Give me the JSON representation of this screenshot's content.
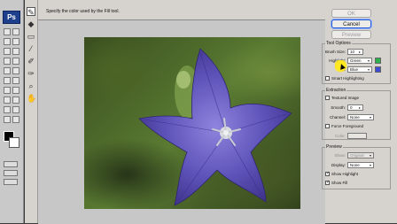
{
  "app": {
    "badge": "Ps"
  },
  "dialog": {
    "status": "Specify the color used by the Fill tool.",
    "buttons": {
      "ok": "OK",
      "cancel": "Cancel",
      "preview": "Preview"
    }
  },
  "tool_options": {
    "title": "Tool Options",
    "brush_size_label": "Brush Size:",
    "brush_size_value": "10",
    "highlight_label": "Highlight:",
    "highlight_value": "Green",
    "fill_label": "Fill:",
    "fill_value": "Blue",
    "smart_highlighting": "Smart Highlighting",
    "colors": {
      "highlight": "#2bb24c",
      "fill": "#3d4bd6"
    }
  },
  "extraction": {
    "title": "Extraction",
    "textured_image": "Textured Image",
    "smooth_label": "Smooth:",
    "smooth_value": "0",
    "channel_label": "Channel:",
    "channel_value": "None",
    "force_foreground": "Force Foreground",
    "color_label": "Color:"
  },
  "preview": {
    "title": "Preview",
    "show_label": "Show:",
    "show_value": "Original",
    "display_label": "Display:",
    "display_value": "None",
    "show_highlight": "Show Highlight",
    "show_fill": "Show Fill"
  }
}
